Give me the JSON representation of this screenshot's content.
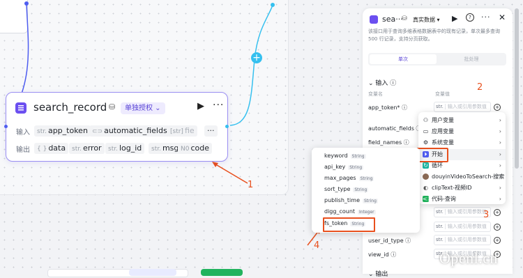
{
  "node": {
    "title": "search_record",
    "auth_label": "单独授权 ⌄",
    "input_label": "输入",
    "output_label": "输出",
    "inputs": [
      {
        "type": "str.",
        "name": "app_token"
      },
      {
        "type": "",
        "name": "automatic_fields"
      },
      {
        "type": "[str]",
        "name": "fie"
      }
    ],
    "outputs": [
      {
        "type": "{ }",
        "name": "data"
      },
      {
        "type": "str.",
        "name": "error"
      },
      {
        "type": "str.",
        "name": "log_id"
      },
      {
        "type": "str.",
        "name": "msg"
      },
      {
        "type": "N0",
        "name": "code"
      }
    ]
  },
  "panel": {
    "title": "sea···",
    "mode": "真实数据 ▾",
    "description": "该接口用于查询多维表格数据表中的现有记录，单次最多查询 500 行记录，支持分页获取。",
    "tab_single": "单次",
    "tab_batch": "批处理",
    "input_section": "输入 ⓘ",
    "col_name": "变量名",
    "col_value": "变量值",
    "params": [
      {
        "name": "app_token* ⓘ"
      },
      {
        "name": "automatic_fields ⓘ"
      },
      {
        "name": "field_names ⓘ"
      },
      {
        "name": "user_id_type ⓘ"
      },
      {
        "name": "view_id ⓘ"
      }
    ],
    "value_prefix": "str.",
    "value_placeholder": "输入或引用参数值",
    "output_section": "输出"
  },
  "menu": {
    "items": [
      {
        "icon": "user-icon",
        "label": "用户变量"
      },
      {
        "icon": "folder-icon",
        "label": "应用变量"
      },
      {
        "icon": "gear-icon",
        "label": "系统变量"
      },
      {
        "icon": "start-icon",
        "label": "开始"
      },
      {
        "icon": "loop-icon",
        "label": "循环"
      },
      {
        "icon": "video-icon",
        "label": "douyinVideoToSearch-搜索"
      },
      {
        "icon": "cliptext-icon",
        "label": "clipText-视频ID"
      },
      {
        "icon": "code-icon",
        "label": "代码-查询"
      }
    ]
  },
  "submenu": {
    "items": [
      {
        "name": "keyword",
        "type": "String"
      },
      {
        "name": "api_key",
        "type": "String"
      },
      {
        "name": "max_pages",
        "type": "String"
      },
      {
        "name": "sort_type",
        "type": "String"
      },
      {
        "name": "publish_time",
        "type": "String"
      },
      {
        "name": "digg_count",
        "type": "Integer"
      },
      {
        "name": "fs_token",
        "type": "String"
      }
    ]
  },
  "annotations": {
    "a1": "1",
    "a2": "2",
    "a3": "3",
    "a4": "4"
  },
  "watermark": "Openl.cn",
  "colors": {
    "accent": "#6b4ff0",
    "annotation": "#e8501e",
    "edge_blue": "#4e5df0",
    "edge_cyan": "#35c0ef"
  }
}
